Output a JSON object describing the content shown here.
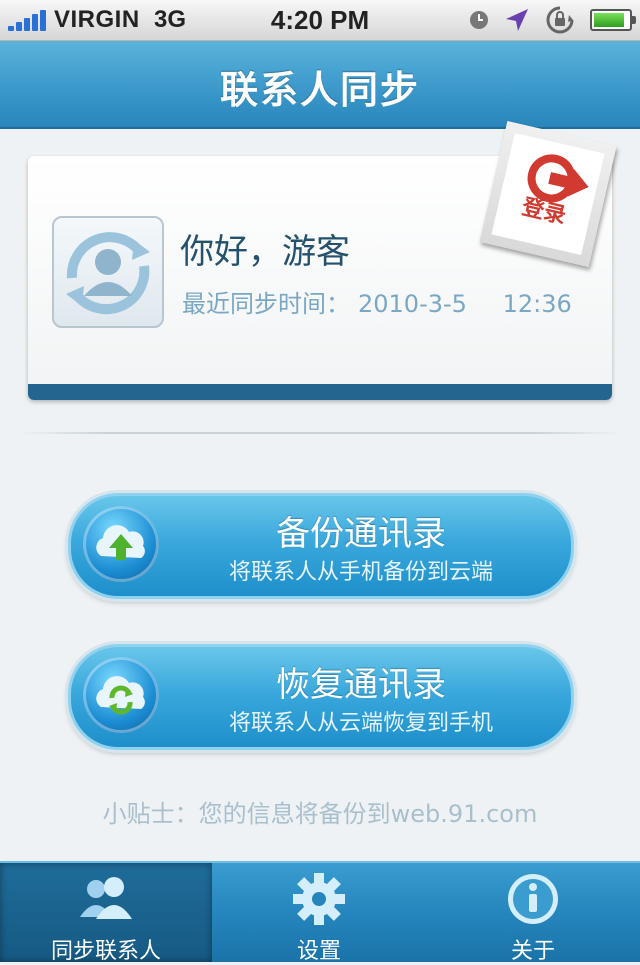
{
  "status_bar": {
    "carrier": "VIRGIN",
    "network": "3G",
    "time": "4:20 PM",
    "icons": [
      "signal-icon",
      "clock-icon",
      "location-arrow-icon",
      "rotation-lock-icon",
      "battery-icon"
    ]
  },
  "nav": {
    "title": "联系人同步"
  },
  "profile": {
    "greeting": "你好，游客",
    "last_sync_label": "最近同步时间：",
    "last_sync_date": "2010-3-5",
    "last_sync_time": "12:36",
    "login_label": "登录"
  },
  "actions": {
    "backup": {
      "title": "备份通讯录",
      "subtitle": "将联系人从手机备份到云端"
    },
    "restore": {
      "title": "恢复通讯录",
      "subtitle": "将联系人从云端恢复到手机"
    }
  },
  "tip": "小贴士：您的信息将备份到web.91.com",
  "tabs": [
    {
      "label": "同步联系人",
      "icon": "contacts-icon",
      "selected": true
    },
    {
      "label": "设置",
      "icon": "gear-icon",
      "selected": false
    },
    {
      "label": "关于",
      "icon": "info-icon",
      "selected": false
    }
  ],
  "colors": {
    "accent": "#3a9ccf",
    "nav_bar": "#3e9bcc",
    "login_red": "#d13a30",
    "card_strip": "#23658e"
  }
}
